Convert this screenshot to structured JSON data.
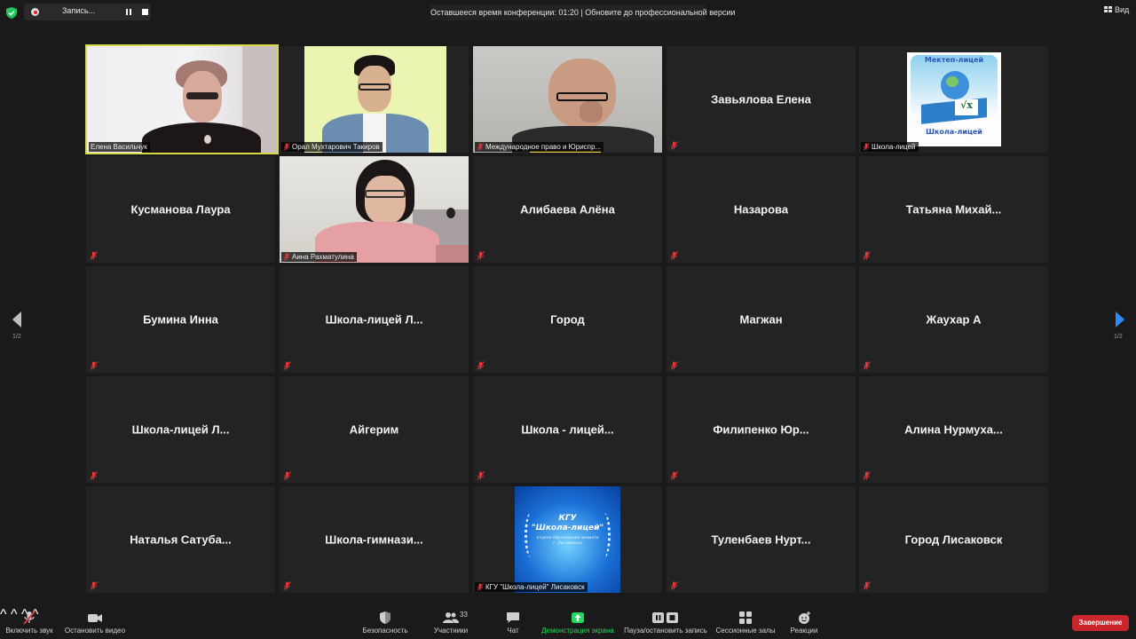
{
  "top_bar": {
    "recording_label": "Запись...",
    "time_banner": "Оставшееся время конференции: 01:20 | Обновите до профессиональной версии",
    "view_label": "Вид"
  },
  "pagination": {
    "left": "1/2",
    "right": "1/2"
  },
  "tiles": [
    {
      "name": "Елена Васильчук",
      "video": true,
      "active": true
    },
    {
      "name": "Орал Мухтарович Такиров",
      "video": true
    },
    {
      "name": "Международное право и Юриспр...",
      "video": true
    },
    {
      "name": "Завьялова Елена",
      "video": false
    },
    {
      "name": "Школа-лицей",
      "video": true,
      "logo_text_top": "Мектеп-лицей",
      "logo_text_bottom": "Школа-лицей"
    },
    {
      "name": "Кусманова Лаура",
      "video": false
    },
    {
      "name": "Аина Рахматулина",
      "video": true
    },
    {
      "name": "Алибаева Алёна",
      "video": false
    },
    {
      "name": "Назарова",
      "video": false
    },
    {
      "name": "Татьяна  Михай...",
      "video": false
    },
    {
      "name": "Бумина Инна",
      "video": false
    },
    {
      "name": "Школа-лицей  Л...",
      "video": false
    },
    {
      "name": "Город",
      "video": false
    },
    {
      "name": "Магжан",
      "video": false
    },
    {
      "name": "Жаухар А",
      "video": false
    },
    {
      "name": "Школа-лицей  Л...",
      "video": false
    },
    {
      "name": "Айгерим",
      "video": false
    },
    {
      "name": "Школа  -  лицей...",
      "video": false
    },
    {
      "name": "Филипенко  Юр...",
      "video": false
    },
    {
      "name": "Алина  Нурмуха...",
      "video": false
    },
    {
      "name": "Наталья  Сатуба...",
      "video": false
    },
    {
      "name": "Школа-гимнази...",
      "video": false
    },
    {
      "name": "КГУ \"Школа-лицей\" Лисаковск",
      "video": true,
      "logo_line1": "КГУ",
      "logo_line2": "\"Школа-лицей\"",
      "logo_line3": "отдела образования акимата г. Лисаковска"
    },
    {
      "name": "Туленбаев  Нурт...",
      "video": false
    },
    {
      "name": "Город Лисаковск",
      "video": false
    }
  ],
  "toolbar": {
    "unmute": "Включить звук",
    "stop_video": "Остановить видео",
    "security": "Безопасность",
    "participants": "Участники",
    "participants_count": "33",
    "chat": "Чат",
    "share": "Демонстрация экрана",
    "pause_record": "Пауза/остановить запись",
    "breakout": "Сессионные залы",
    "reactions": "Реакции",
    "end": "Завершение"
  },
  "colors": {
    "background": "#1a1a1a",
    "tile": "#232323",
    "active_border": "#d6d94a",
    "share_green": "#23d959",
    "end_red": "#c9262b",
    "mute_red": "#e0393e",
    "arrow_blue": "#2d8cff"
  }
}
